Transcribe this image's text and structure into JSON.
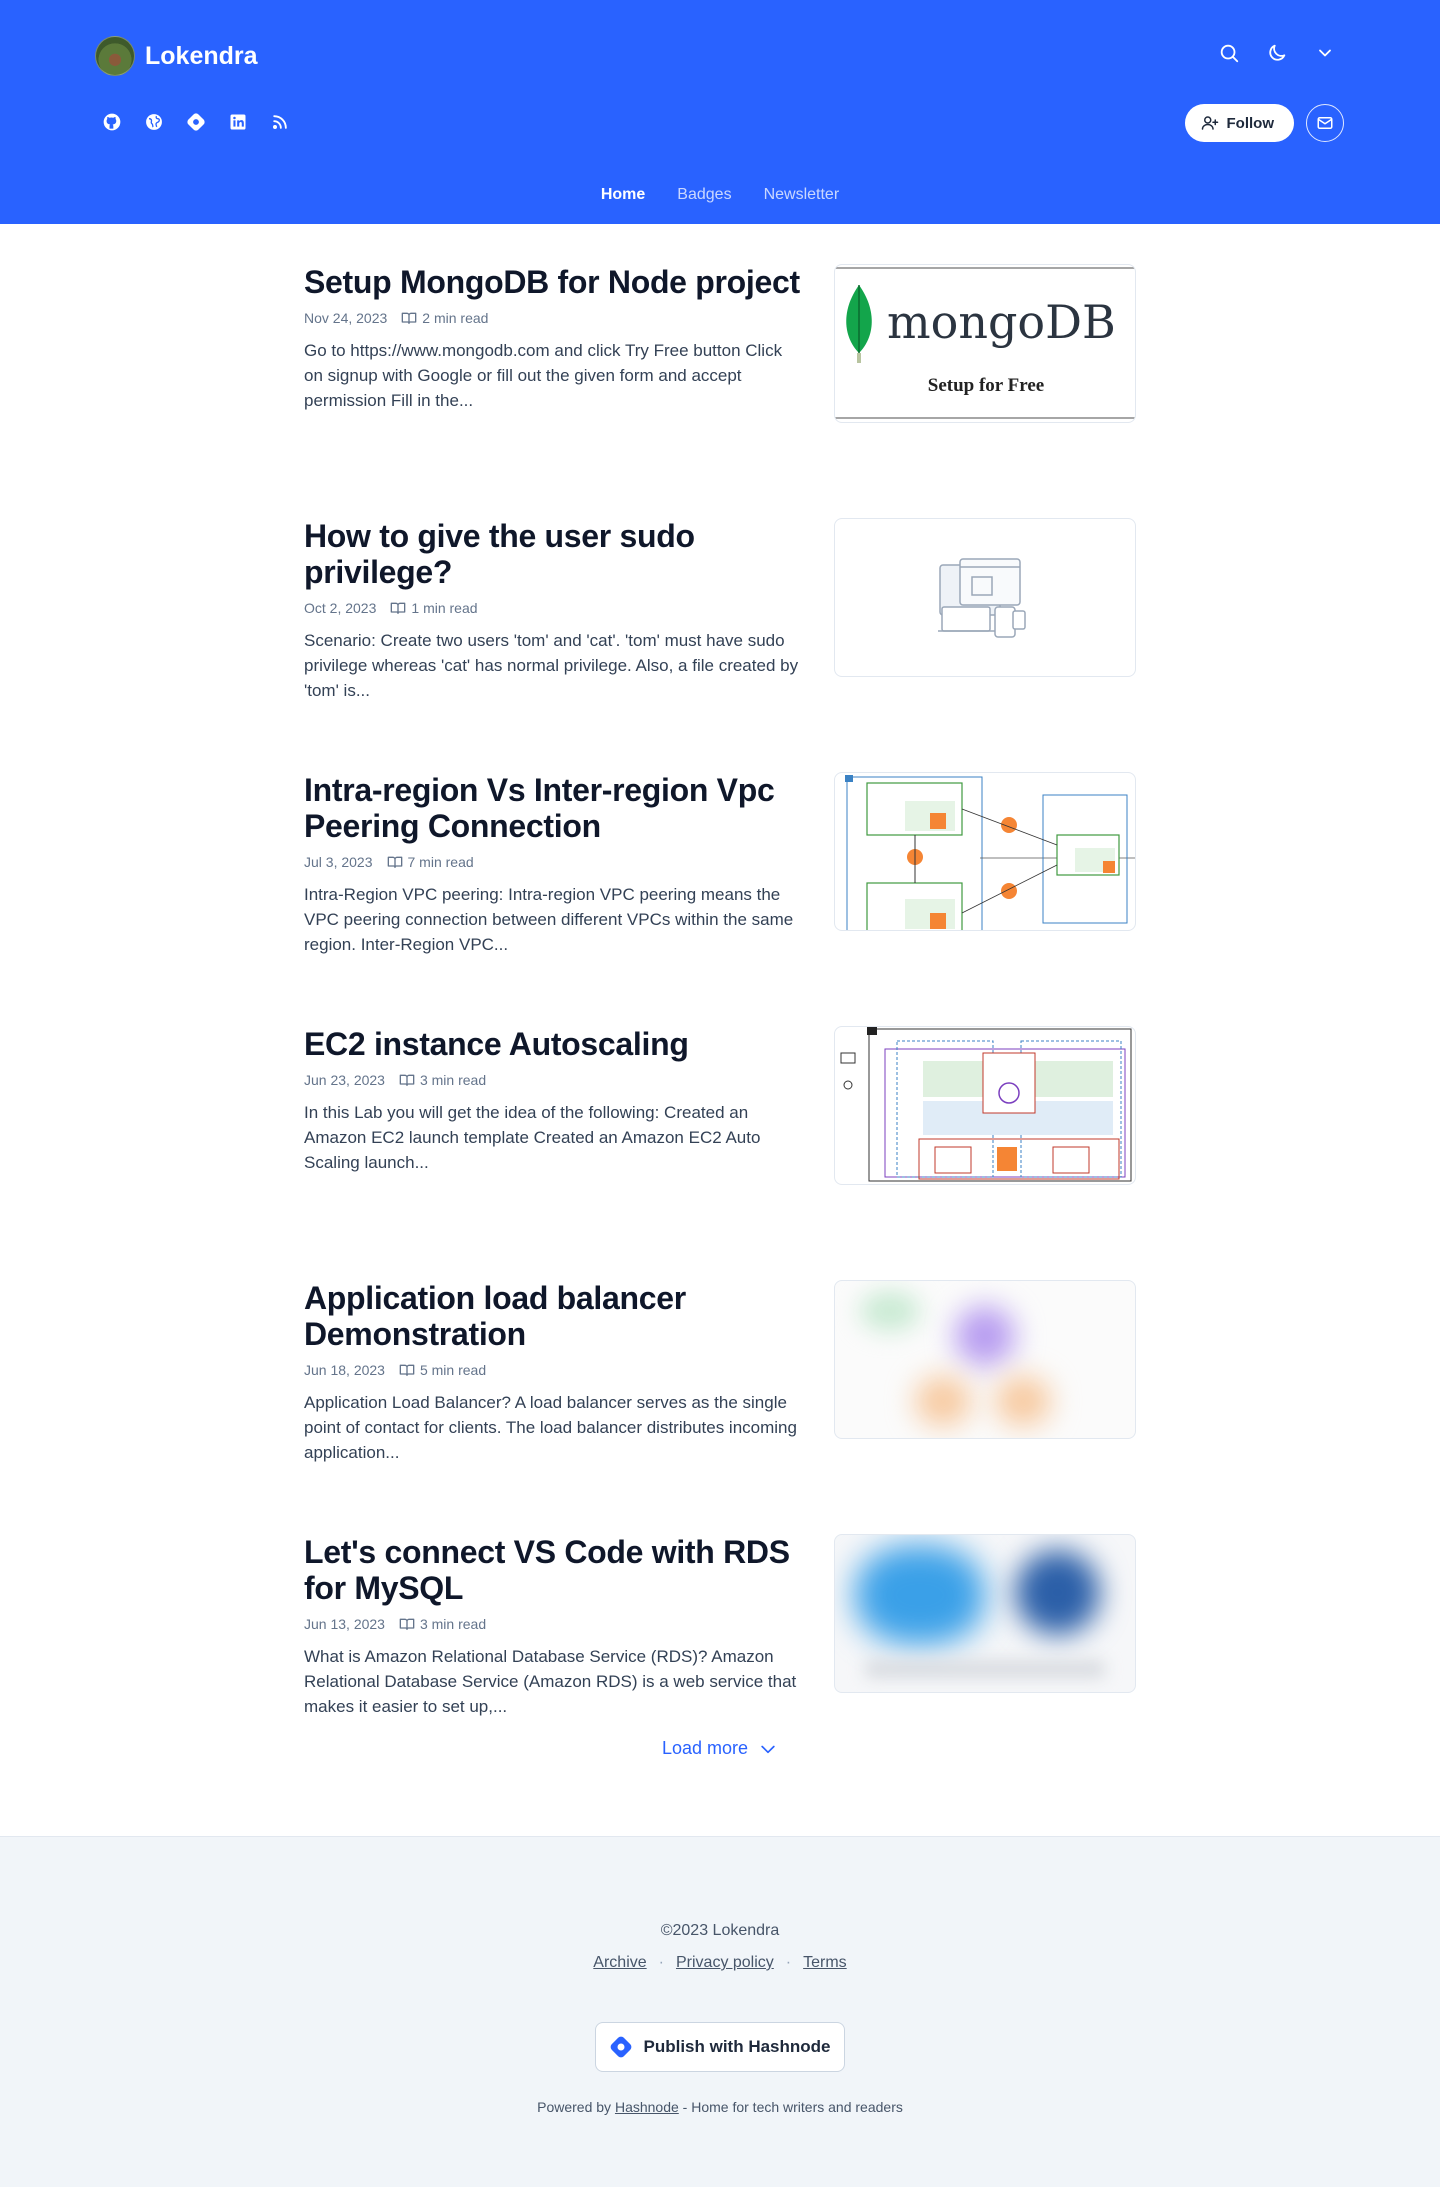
{
  "header": {
    "brand_name": "Lokendra",
    "follow_label": "Follow",
    "nav": [
      "Home",
      "Badges",
      "Newsletter"
    ]
  },
  "posts": [
    {
      "title": "Setup MongoDB for Node project",
      "date": "Nov 24, 2023",
      "read_time": "2 min read",
      "excerpt": "Go to https://www.mongodb.com and click Try Free button Click on signup with Google or fill out the given form and accept permission Fill in the...",
      "thumb_text": "mongoDB",
      "thumb_sub": "Setup for Free"
    },
    {
      "title": "How to give the user sudo privilege?",
      "date": "Oct 2, 2023",
      "read_time": "1 min read",
      "excerpt": "Scenario: Create two users 'tom' and 'cat'. 'tom' must have sudo privilege whereas 'cat' has normal privilege. Also, a file created by 'tom' is..."
    },
    {
      "title": "Intra-region Vs Inter-region Vpc Peering Connection",
      "date": "Jul 3, 2023",
      "read_time": "7 min read",
      "excerpt": "Intra-Region VPC peering: Intra-region VPC peering means the VPC peering connection between different VPCs within the same region. Inter-Region VPC..."
    },
    {
      "title": "EC2 instance Autoscaling",
      "date": "Jun 23, 2023",
      "read_time": "3 min read",
      "excerpt": "In this Lab you will get the idea of the following: Created an Amazon EC2 launch template Created an Amazon EC2 Auto Scaling launch..."
    },
    {
      "title": "Application load balancer Demonstration",
      "date": "Jun 18, 2023",
      "read_time": "5 min read",
      "excerpt": "Application Load Balancer? A load balancer serves as the single point of contact for clients. The load balancer distributes incoming application..."
    },
    {
      "title": "Let's connect VS Code with RDS for MySQL",
      "date": "Jun 13, 2023",
      "read_time": "3 min read",
      "excerpt": "What is Amazon Relational Database Service (RDS)? Amazon Relational Database Service (Amazon RDS) is a web service that makes it easier to set up,..."
    }
  ],
  "load_more": "Load more",
  "footer": {
    "copyright": "©2023 Lokendra",
    "links": [
      "Archive",
      "Privacy policy",
      "Terms"
    ],
    "publish_label": "Publish with Hashnode",
    "powered_prefix": "Powered by",
    "powered_link": "Hashnode",
    "powered_suffix": "- Home for tech writers and readers"
  },
  "colors": {
    "brand": "#2962ff",
    "footer_bg": "#f1f5f9",
    "title": "#0f172a"
  }
}
